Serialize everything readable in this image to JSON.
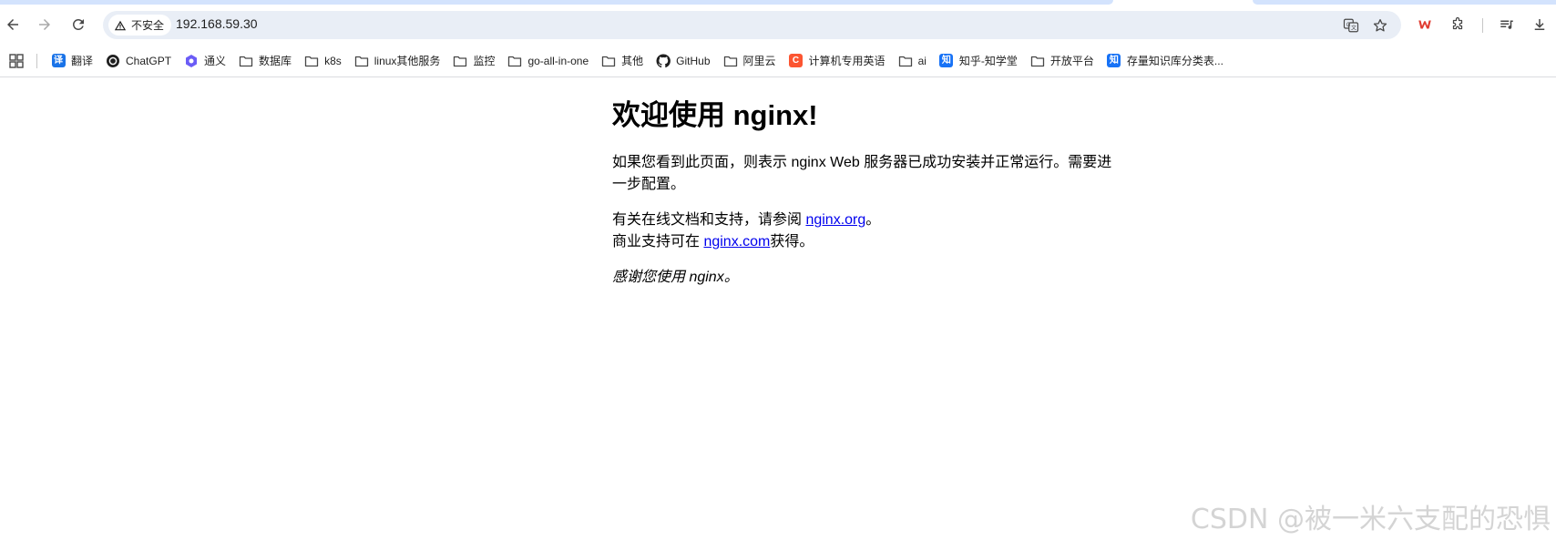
{
  "browser": {
    "security_label": "不安全",
    "url": "192.168.59.30"
  },
  "bookmarks": [
    {
      "label": "翻译",
      "icon": "translate-favicon",
      "color": "#1a73e8",
      "glyph": "译"
    },
    {
      "label": "ChatGPT",
      "icon": "chatgpt-favicon"
    },
    {
      "label": "通义",
      "icon": "tongyi-favicon",
      "color": "#6b5cf6"
    },
    {
      "label": "数据库",
      "icon": "folder-icon"
    },
    {
      "label": "k8s",
      "icon": "folder-icon"
    },
    {
      "label": "linux其他服务",
      "icon": "folder-icon"
    },
    {
      "label": "监控",
      "icon": "folder-icon"
    },
    {
      "label": "go-all-in-one",
      "icon": "folder-icon"
    },
    {
      "label": "其他",
      "icon": "folder-icon"
    },
    {
      "label": "GitHub",
      "icon": "github-favicon"
    },
    {
      "label": "阿里云",
      "icon": "folder-icon"
    },
    {
      "label": "计算机专用英语",
      "icon": "csdn-favicon",
      "color": "#fc5531",
      "glyph": "C"
    },
    {
      "label": "ai",
      "icon": "folder-icon"
    },
    {
      "label": "知乎-知学堂",
      "icon": "zhihu-favicon",
      "color": "#1772f6",
      "glyph": "知"
    },
    {
      "label": "开放平台",
      "icon": "folder-icon"
    },
    {
      "label": "存量知识库分类表...",
      "icon": "zhihu-favicon",
      "color": "#1772f6",
      "glyph": "知"
    }
  ],
  "page": {
    "heading": "欢迎使用 nginx!",
    "para1": "如果您看到此页面，则表示 nginx Web 服务器已成功安装并正常运行。需要进一步配置。",
    "para2_prefix": "有关在线文档和支持，请参阅 ",
    "para2_link": "nginx.org",
    "para2_suffix": "。",
    "para3_prefix": "商业支持可在 ",
    "para3_link": "nginx.com",
    "para3_suffix": "获得。",
    "thanks": "感谢您使用 nginx。"
  },
  "watermark": "CSDN @被一米六支配的恐惧"
}
